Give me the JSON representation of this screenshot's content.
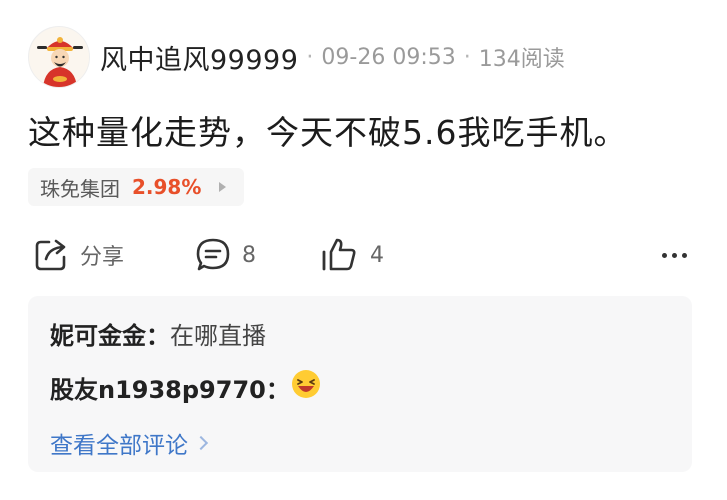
{
  "post": {
    "author": "风中追风99999",
    "separator": "·",
    "time": "09-26 09:53",
    "reads": "134阅读",
    "content": "这种量化走势，今天不破5.6我吃手机。",
    "stock": {
      "name": "珠免集团",
      "change": "2.98%",
      "change_color": "#e8502a"
    }
  },
  "actions": {
    "share_label": "分享",
    "comment_count": "8",
    "like_count": "4"
  },
  "comments": {
    "items": [
      {
        "author": "妮可金金",
        "colon": "：",
        "text": "在哪直播"
      },
      {
        "author": "股友n1938p9770",
        "colon": "：",
        "emoji": "😆"
      }
    ],
    "view_all_label": "查看全部评论"
  },
  "colors": {
    "accent_link": "#3f77c8",
    "stock_up": "#e8502a"
  }
}
